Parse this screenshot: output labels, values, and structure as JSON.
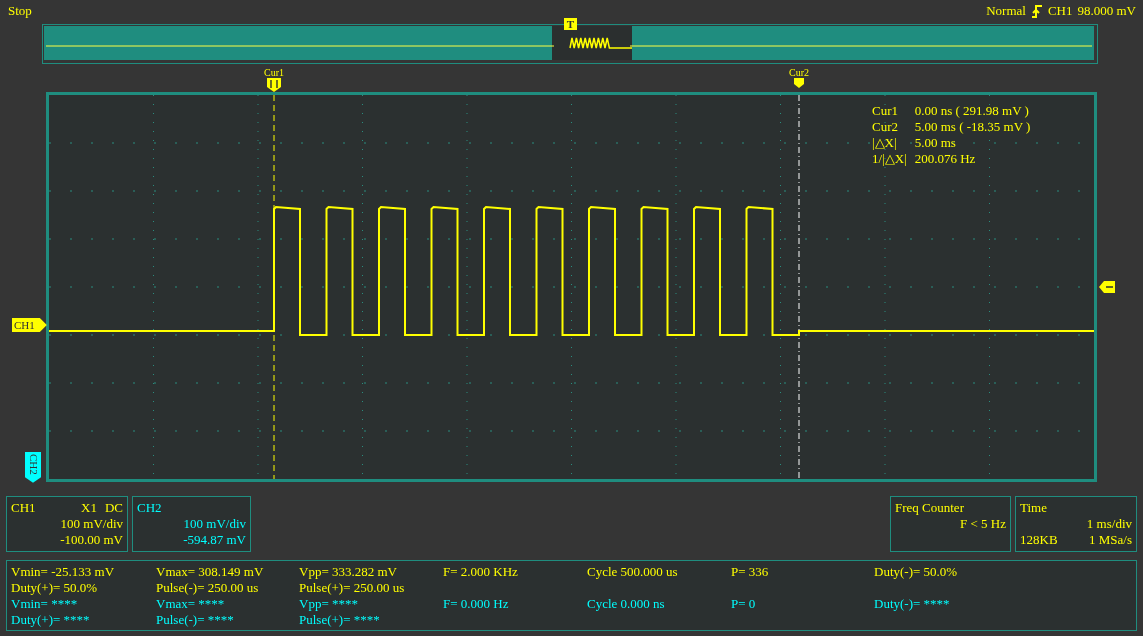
{
  "status": "Stop",
  "trigger": {
    "mode": "Normal",
    "source": "CH1",
    "level": "98.000 mV"
  },
  "overview": {
    "marker": "T"
  },
  "cursors": [
    {
      "label": "Cur1",
      "kind": "solid"
    },
    {
      "label": "Cur2",
      "kind": "small"
    }
  ],
  "cursor_readout": [
    {
      "label": "Cur1",
      "value": "0.00 ns ( 291.98 mV )"
    },
    {
      "label": "Cur2",
      "value": "5.00 ms ( -18.35 mV )"
    },
    {
      "label": "|△X|",
      "value": "5.00 ms"
    },
    {
      "label": "1/|△X|",
      "value": "200.076 Hz"
    }
  ],
  "channel_markers": [
    {
      "label": "CH1",
      "color": "#ffff00"
    },
    {
      "label": "CH2",
      "color": "#00ffff"
    }
  ],
  "channels": [
    {
      "name": "CH1",
      "probe": "X1",
      "coupling": "DC",
      "scale": "100 mV/div",
      "offset": "-100.00 mV",
      "color": "#ffff00"
    },
    {
      "name": "CH2",
      "scale": "100 mV/div",
      "offset": "-594.87 mV",
      "color": "#00ffff"
    }
  ],
  "freq_counter": {
    "title": "Freq Counter",
    "value": "F < 5 Hz"
  },
  "timebase": {
    "title": "Time",
    "scale": "1 ms/div",
    "memory": "128KB",
    "sample_rate": "1 MSa/s"
  },
  "measurements": [
    {
      "color": "#ffff00",
      "items": [
        "Vmin= -25.133 mV",
        "Vmax= 308.149 mV",
        "Vpp= 333.282 mV",
        "F= 2.000 KHz",
        "Cycle 500.000 us",
        "P= 336",
        "Duty(-)= 50.0%",
        "Duty(+)= 50.0%",
        "Pulse(-)= 250.00 us",
        "Pulse(+)= 250.00 us"
      ]
    },
    {
      "color": "#00ffff",
      "items": [
        "Vmin= ****",
        "Vmax= ****",
        "Vpp= ****",
        "F= 0.000 Hz",
        "Cycle 0.000 ns",
        "P= 0",
        "Duty(-)= ****",
        "Duty(+)= ****",
        "Pulse(-)= ****",
        "Pulse(+)= ****"
      ]
    }
  ]
}
